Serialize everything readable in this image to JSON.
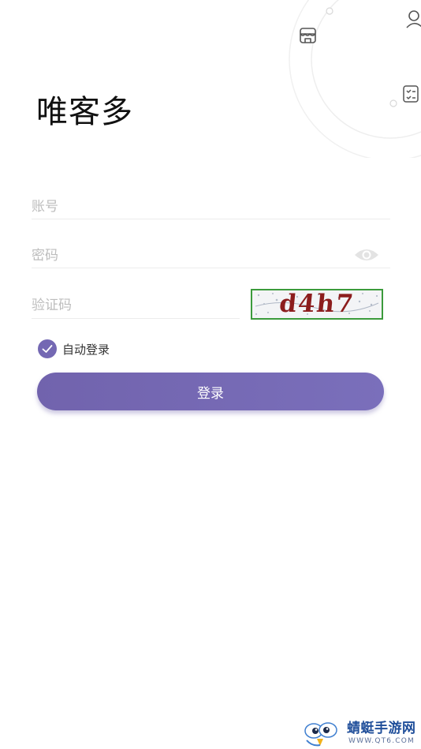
{
  "app": {
    "title": "唯客多"
  },
  "form": {
    "account_placeholder": "账号",
    "password_placeholder": "密码",
    "captcha_placeholder": "验证码",
    "captcha_image_text": "d4h7",
    "remember_label": "自动登录",
    "remember_checked": true,
    "login_label": "登录"
  },
  "decorations": {
    "icons": [
      "store-icon",
      "user-icon",
      "checklist-icon"
    ]
  },
  "watermark": {
    "name": "蜻蜓手游网",
    "url": "WWW.QT6.COM"
  },
  "colors": {
    "accent": "#7468b3",
    "captcha_border": "#3c9b3c",
    "captcha_text": "#8c1d1d",
    "watermark_text": "#1f4e9a"
  }
}
